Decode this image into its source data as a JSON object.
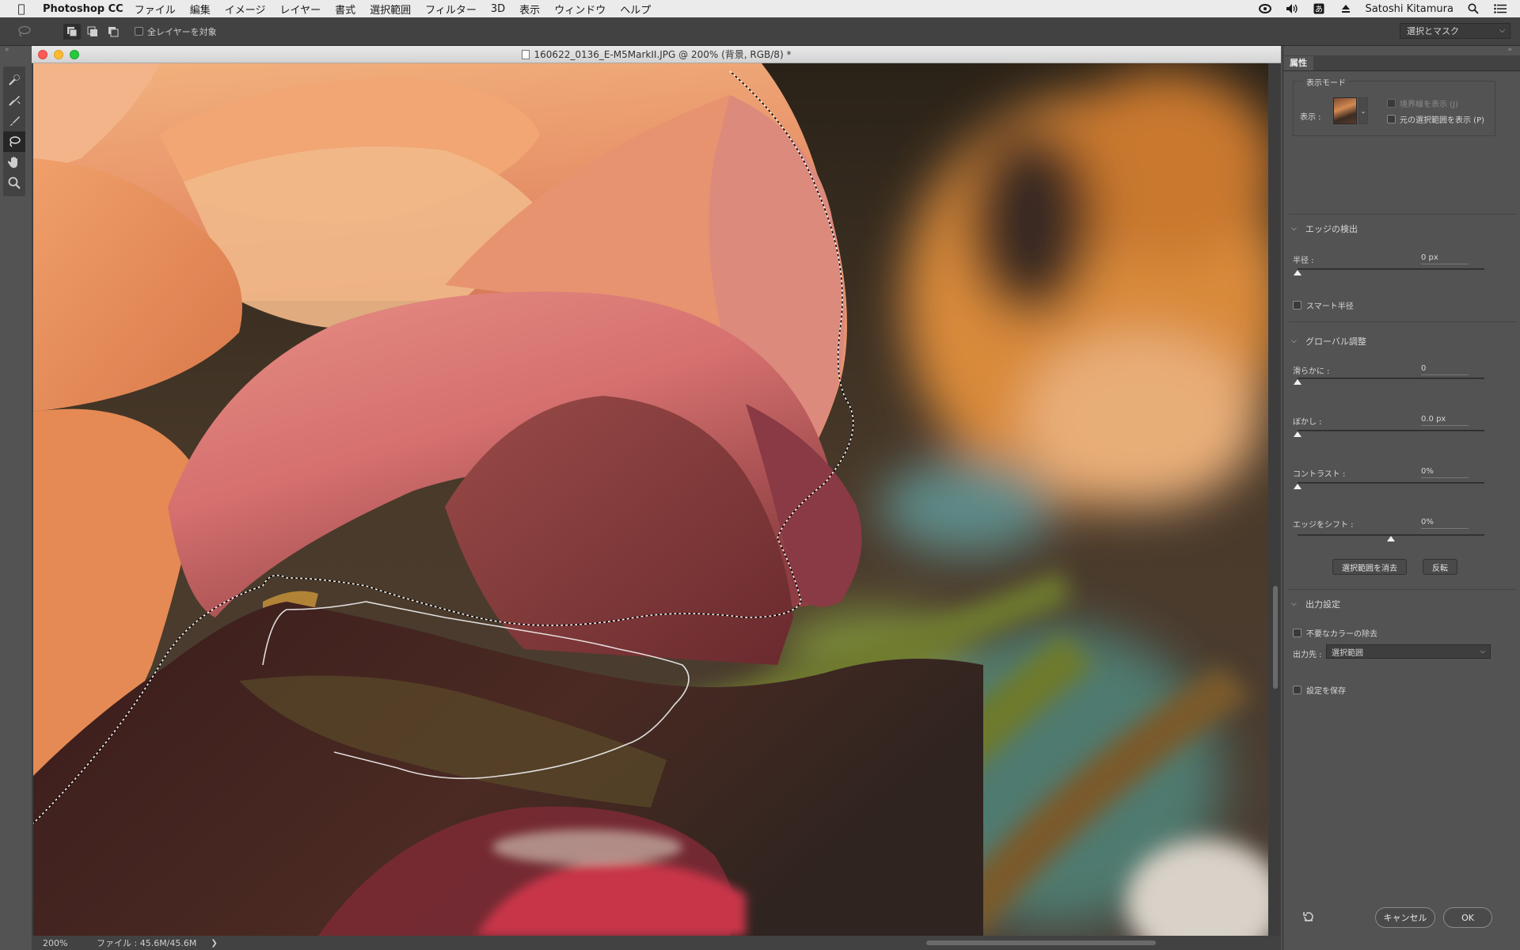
{
  "menubar": {
    "app_name": "Photoshop CC",
    "items": [
      "ファイル",
      "編集",
      "イメージ",
      "レイヤー",
      "書式",
      "選択範囲",
      "フィルター",
      "3D",
      "表示",
      "ウィンドウ",
      "ヘルプ"
    ],
    "user": "Satoshi Kitamura"
  },
  "options": {
    "sample_all_layers": "全レイヤーを対象",
    "workspace": "選択とマスク"
  },
  "document": {
    "title": "160622_0136_E-M5MarkII.JPG @ 200% (背景, RGB/8) *",
    "zoom": "200%",
    "file_info": "ファイル : 45.6M/45.6M"
  },
  "panel": {
    "tab": "属性",
    "view_mode": {
      "legend": "表示モード",
      "view_label": "表示 :",
      "show_edge": "境界線を表示 (J)",
      "show_original": "元の選択範囲を表示 (P)"
    },
    "edge_detection": {
      "title": "エッジの検出",
      "radius_label": "半径 :",
      "radius_value": "0 px",
      "radius_level": 0,
      "smart_radius": "スマート半径"
    },
    "global": {
      "title": "グローバル調整",
      "smooth_label": "滑らかに :",
      "smooth_value": "0",
      "smooth_level": 0,
      "feather_label": "ぼかし :",
      "feather_value": "0.0 px",
      "feather_level": 0,
      "contrast_label": "コントラスト :",
      "contrast_value": "0%",
      "contrast_level": 0,
      "shift_label": "エッジをシフト :",
      "shift_value": "0%",
      "shift_level": 0.5,
      "clear_button": "選択範囲を消去",
      "invert_button": "反転"
    },
    "output": {
      "title": "出力設定",
      "decontaminate": "不要なカラーの除去",
      "output_to_label": "出力先 :",
      "output_to_value": "選択範囲",
      "remember": "設定を保存"
    },
    "cancel_button": "キャンセル",
    "ok_button": "OK"
  }
}
